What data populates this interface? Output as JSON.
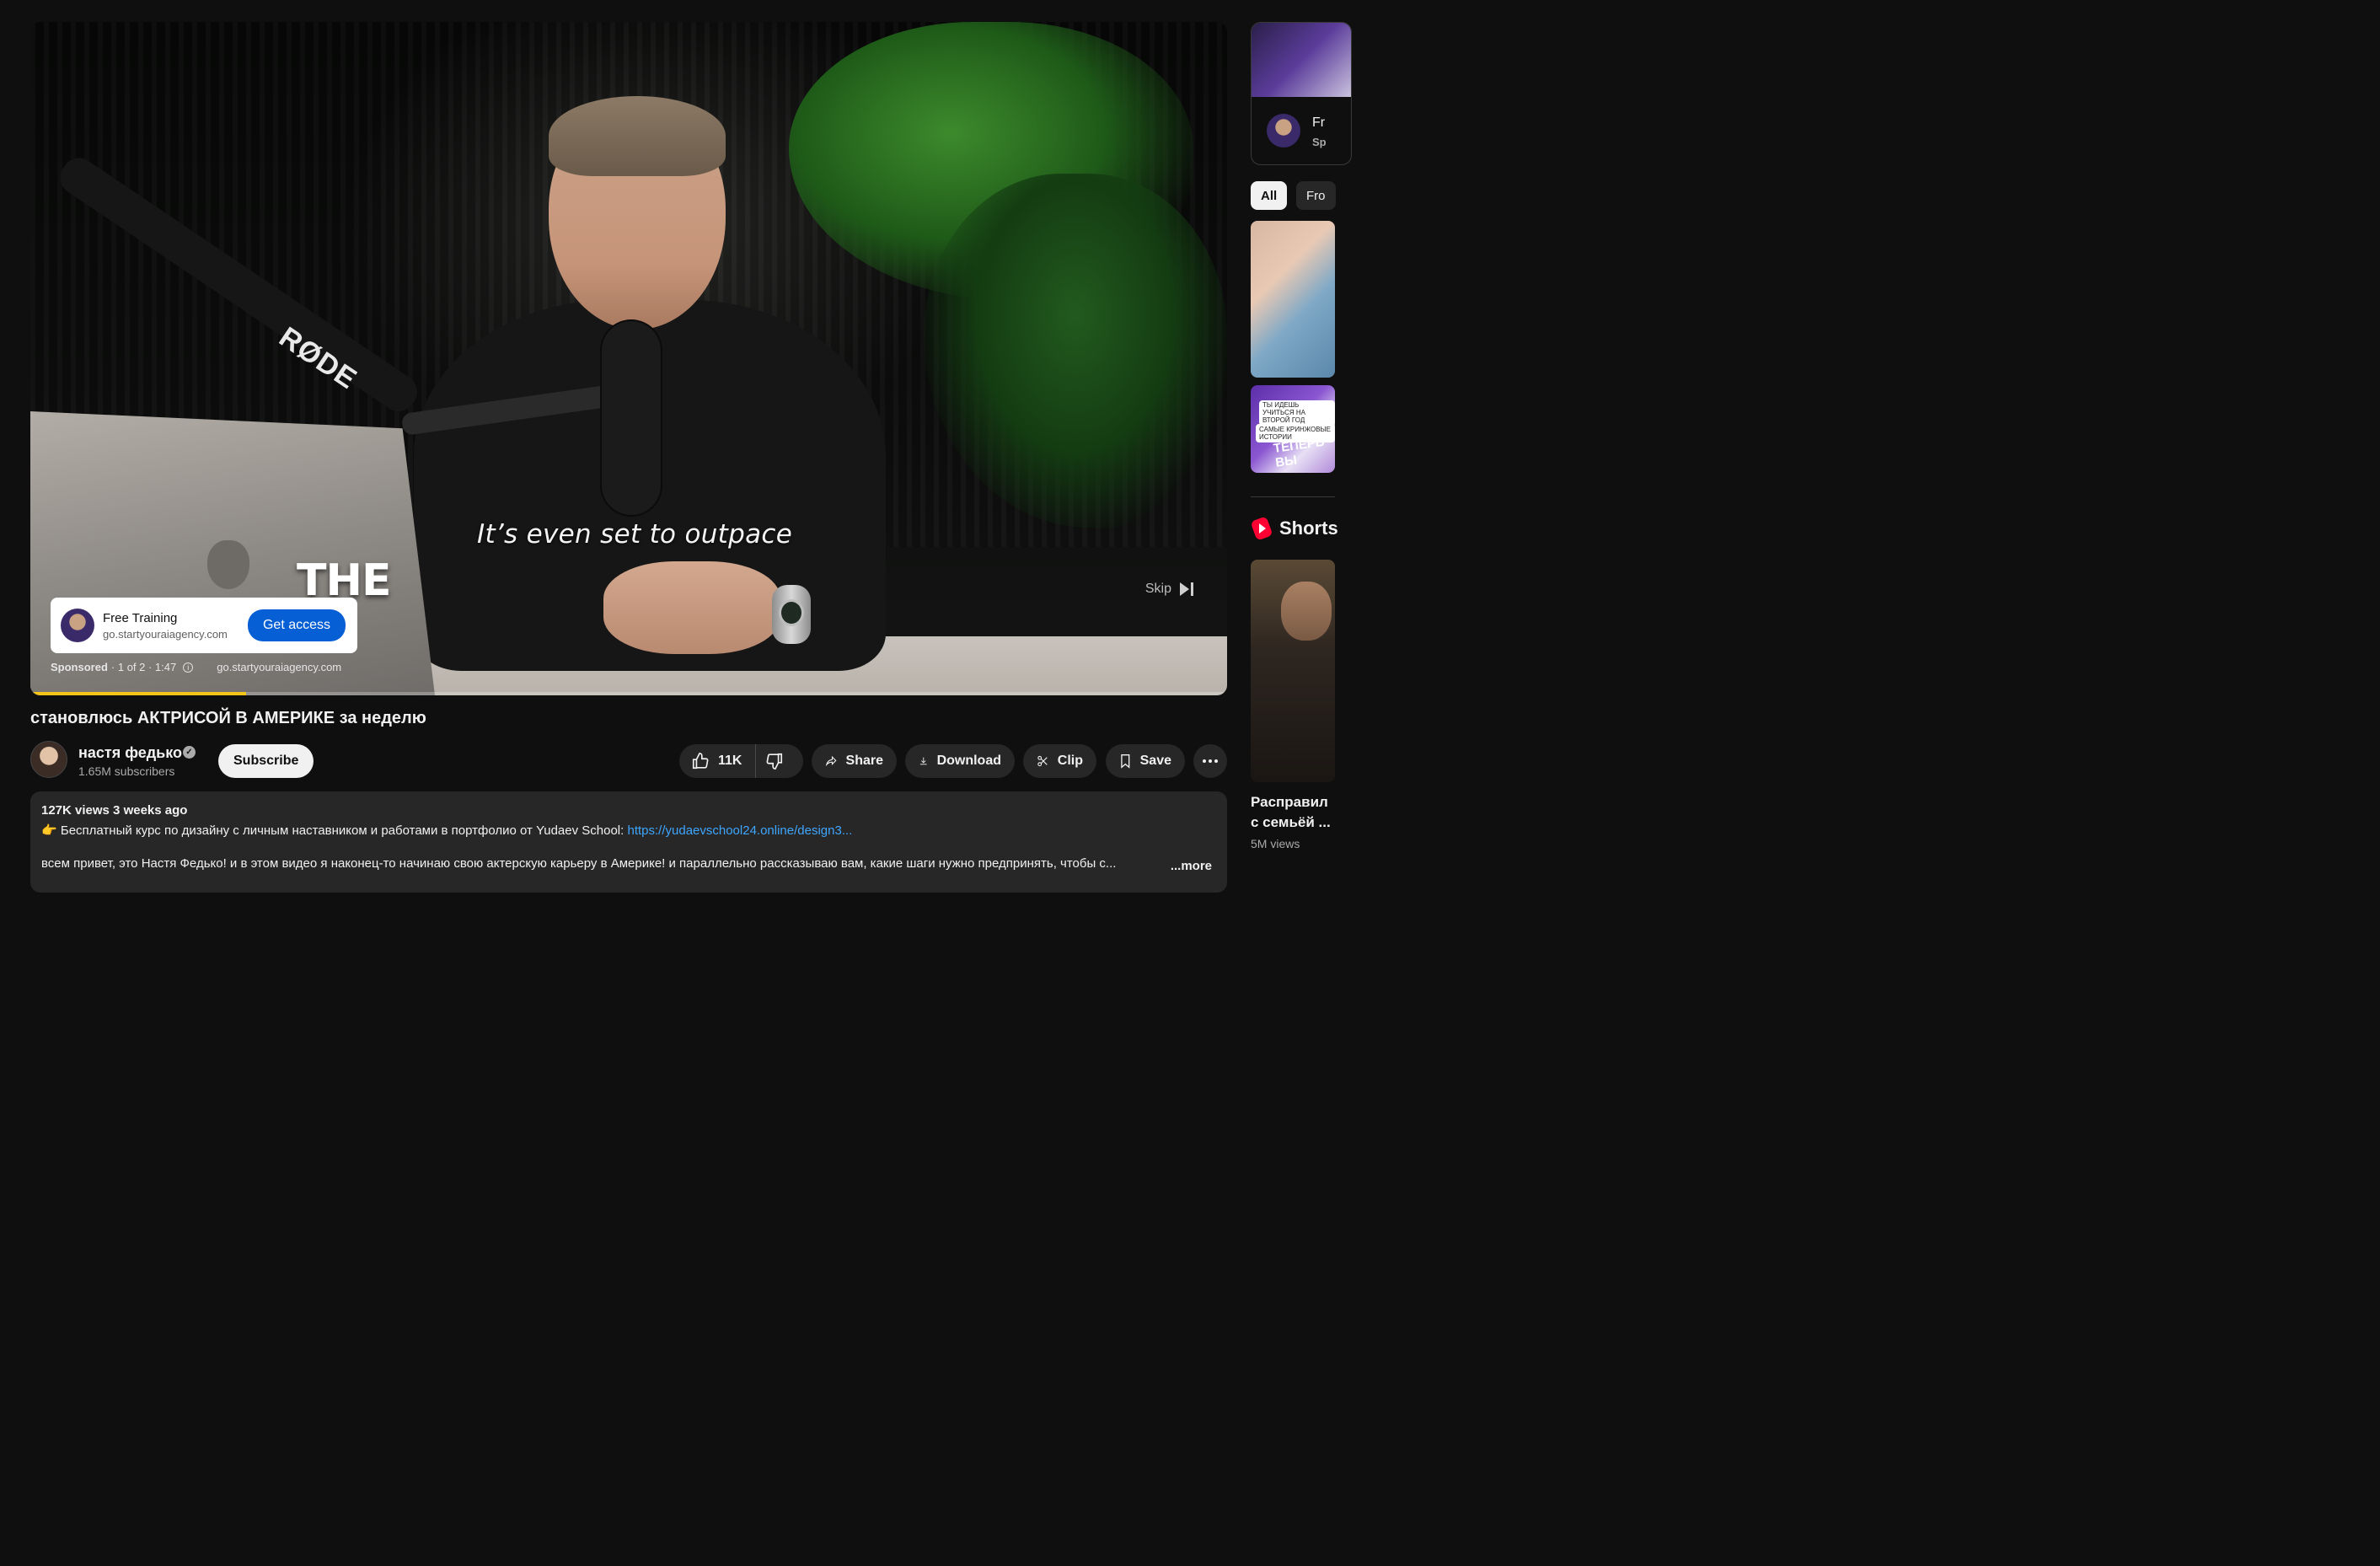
{
  "player": {
    "caption": "It’s even set to outpace",
    "overlay_word": "THE",
    "mic_brand": "RØDE",
    "skip_label": "Skip",
    "progress_fraction": 0.18
  },
  "ad": {
    "title": "Free Training",
    "url": "go.startyouraiagency.com",
    "button_label": "Get access",
    "sponsored_label": "Sponsored",
    "counter": "· 1 of 2 · 1:47",
    "meta_url": "go.startyouraiagency.com"
  },
  "video": {
    "title": "становлюсь АКТРИСОЙ В АМЕРИКЕ за неделю",
    "channel_name": "настя федько",
    "subscribers": "1.65M subscribers",
    "subscribe_label": "Subscribe",
    "likes": "11K",
    "share_label": "Share",
    "download_label": "Download",
    "clip_label": "Clip",
    "save_label": "Save"
  },
  "description": {
    "meta": "127K views  3 weeks ago",
    "line1_prefix": "👉 Бесплатный курс по дизайну с личным наставником и работами в портфолио от Yudaev School: ",
    "line1_link": "https://yudaevschool24.online/design3...",
    "body": "всем привет, это Настя Федько! и в этом видео я наконец-то начинаю свою актерскую карьеру в Америке! и параллельно рассказываю вам, какие шаги нужно предпринять, чтобы с...",
    "more_label": "...more"
  },
  "sidebar": {
    "ad_title": "Fr",
    "ad_sub": "Sp",
    "chips": [
      "All",
      "Fro"
    ],
    "rec2_small1": "ТЫ ИДЕШЬ УЧИТЬСЯ НА ВТОРОЙ ГОД",
    "rec2_small2": "САМЫЕ КРИНЖОВЫЕ ИСТОРИИ",
    "rec2_big": "ТЕПЕРЬ ВЫ",
    "shorts_label": "Shorts",
    "short_title_line1": "Расправил",
    "short_title_line2": "с семьёй ...",
    "short_views": "5M views"
  },
  "colors": {
    "background": "#0f0f0f",
    "pill": "#272727",
    "link": "#3ea6ff",
    "ad_button": "#065fd4",
    "progress": "#f5c518",
    "shorts_red": "#ff0033"
  },
  "icons": [
    "like-icon",
    "dislike-icon",
    "share-icon",
    "download-icon",
    "clip-icon",
    "save-icon",
    "more-icon",
    "info-icon",
    "skip-icon",
    "verified-icon",
    "shorts-icon"
  ]
}
